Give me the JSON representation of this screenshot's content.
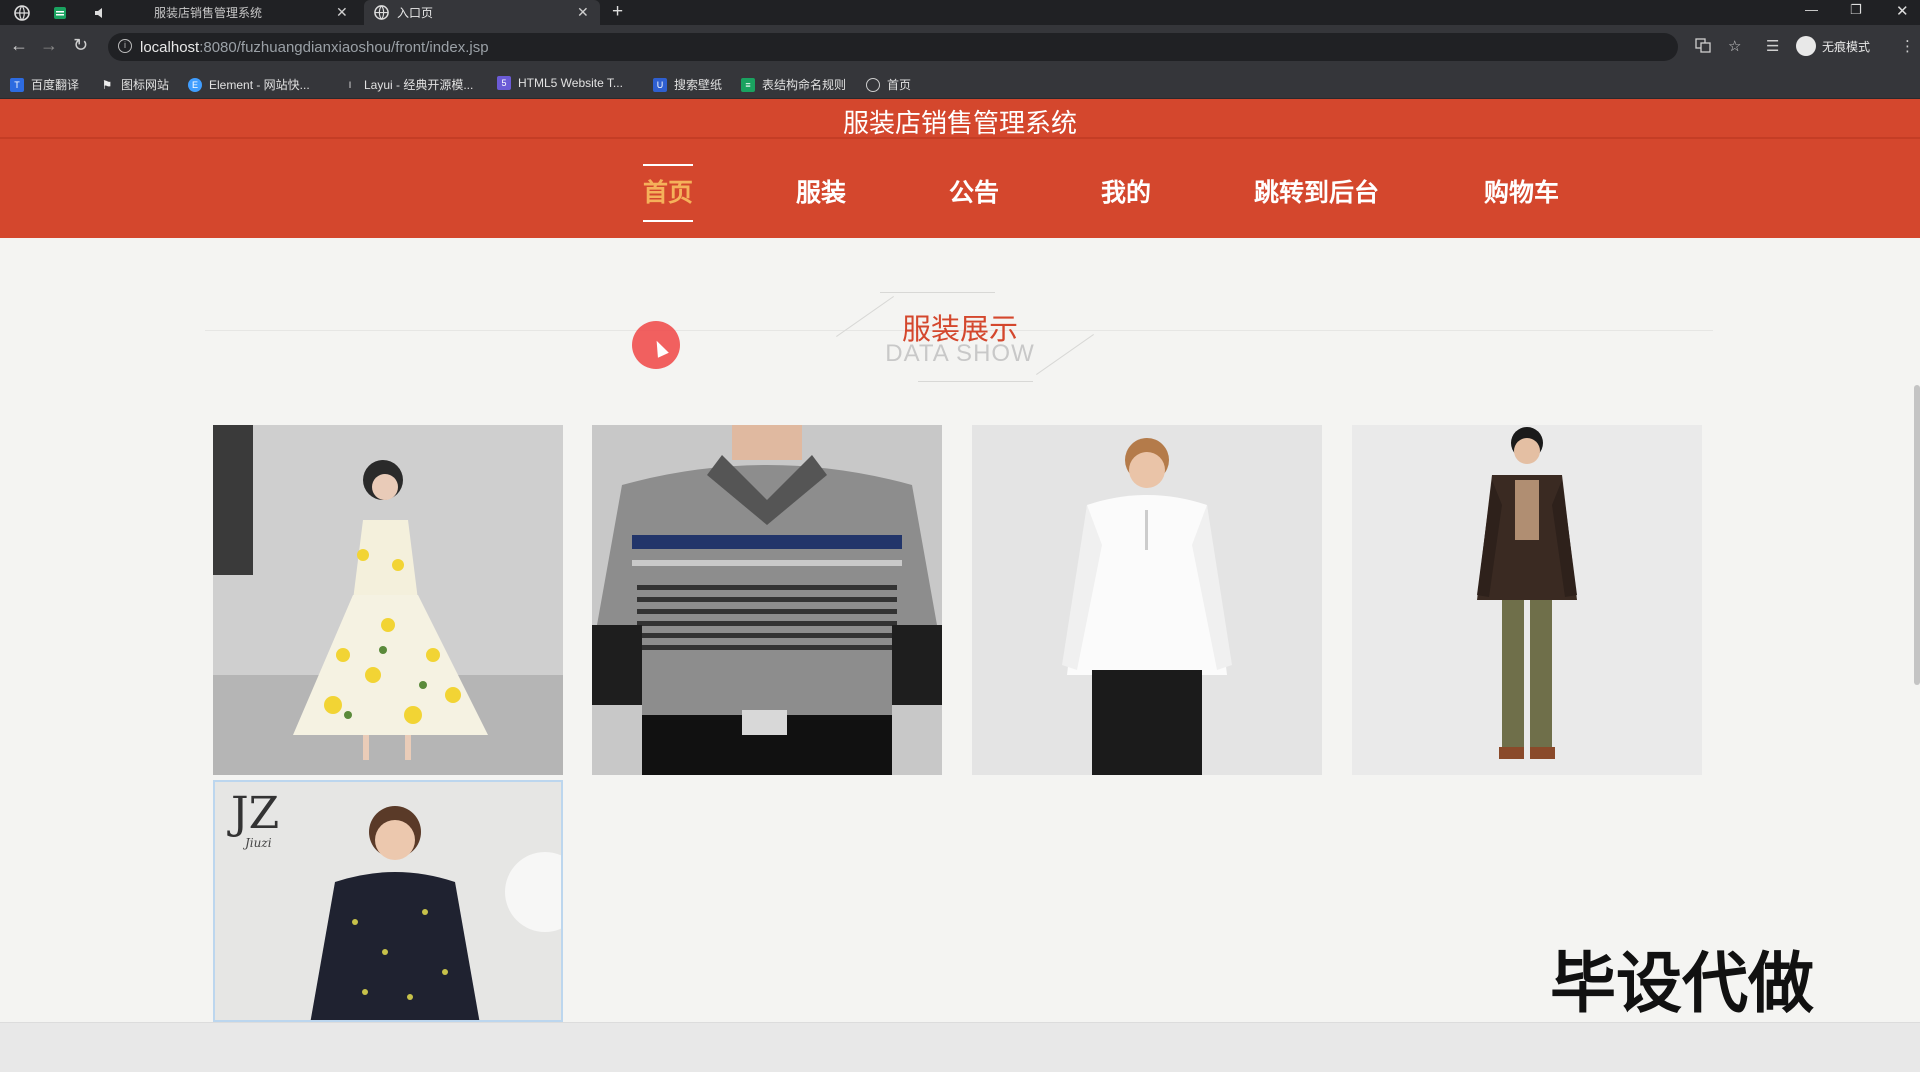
{
  "browser": {
    "tabs": [
      {
        "title": "服装店销售管理系统",
        "active": false
      },
      {
        "title": "入口页",
        "active": true
      }
    ],
    "url_host": "localhost",
    "url_path": ":8080/fuzhuangdianxiaoshou/front/index.jsp",
    "profile_label": "无痕模式",
    "bookmarks": [
      {
        "label": "百度翻译",
        "icon": "translate-icon",
        "color": "#2d6be0"
      },
      {
        "label": "图标网站",
        "icon": "flag-icon",
        "color": "#555555"
      },
      {
        "label": "Element - 网站快...",
        "icon": "element-icon",
        "color": "#409eff"
      },
      {
        "label": "Layui - 经典开源模...",
        "icon": "layui-icon",
        "color": "#333333"
      },
      {
        "label": "HTML5 Website T...",
        "icon": "html5-icon",
        "color": "#6b5bd6"
      },
      {
        "label": "搜索壁纸",
        "icon": "wallpaper-icon",
        "color": "#2f5fd0"
      },
      {
        "label": "表结构命名规则",
        "icon": "sheet-icon",
        "color": "#1aa260"
      },
      {
        "label": "首页",
        "icon": "globe-icon",
        "color": "#888888"
      }
    ]
  },
  "site": {
    "title": "服装店销售管理系统",
    "nav": [
      {
        "label": "首页",
        "active": true
      },
      {
        "label": "服装",
        "active": false
      },
      {
        "label": "公告",
        "active": false
      },
      {
        "label": "我的",
        "active": false
      },
      {
        "label": "跳转到后台",
        "active": false
      },
      {
        "label": "购物车",
        "active": false
      }
    ],
    "accent_color": "#d4472d",
    "active_nav_color": "#f5b15a"
  },
  "section": {
    "title": "服装展示",
    "subtitle": "DATA SHOW"
  },
  "products": [
    {
      "image": "floral-dress-photo"
    },
    {
      "image": "striped-polo-photo"
    },
    {
      "image": "white-shirt-photo"
    },
    {
      "image": "dark-jacket-photo"
    },
    {
      "image": "floral-blouse-photo",
      "logo": "JZ",
      "logo_sub": "Jiuzi"
    }
  ],
  "overlay": {
    "watermark": "毕设代做"
  }
}
